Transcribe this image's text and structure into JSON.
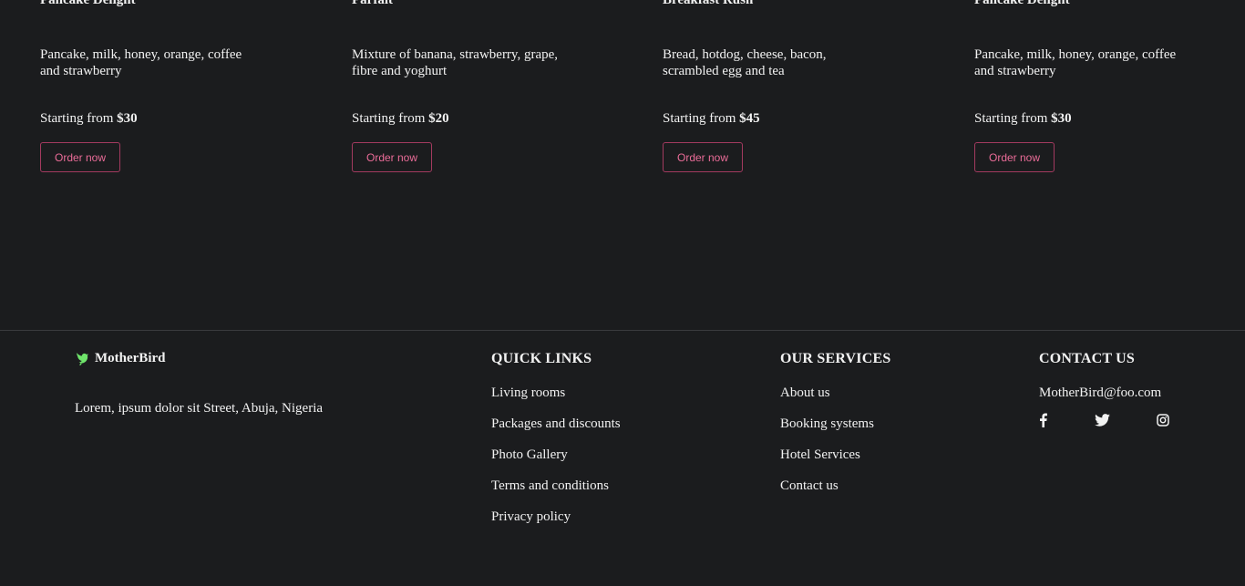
{
  "menu_cards": [
    {
      "title": "Pancake Delight",
      "description": "Pancake, milk, honey, orange, coffee and strawberry",
      "price_prefix": "Starting from ",
      "price": "$30",
      "button_label": "Order now"
    },
    {
      "title": "Parfait",
      "description": "Mixture of banana, strawberry, grape, fibre and yoghurt",
      "price_prefix": "Starting from ",
      "price": "$20",
      "button_label": "Order now"
    },
    {
      "title": "Breakfast Rush",
      "description": "Bread, hotdog, cheese, bacon, scrambled egg and tea",
      "price_prefix": "Starting from ",
      "price": "$45",
      "button_label": "Order now"
    },
    {
      "title": "Pancake Delight",
      "description": "Pancake, milk, honey, orange, coffee and strawberry",
      "price_prefix": "Starting from ",
      "price": "$30",
      "button_label": "Order now"
    }
  ],
  "footer": {
    "brand": {
      "name": "MotherBird",
      "logo_icon": "bird-icon",
      "logo_color": "#6fe46b"
    },
    "address": "Lorem, ipsum dolor sit Street, Abuja, Nigeria",
    "quick_links": {
      "heading": "QUICK LINKS",
      "items": [
        "Living rooms",
        "Packages and discounts",
        "Photo Gallery",
        "Terms and conditions",
        "Privacy policy"
      ]
    },
    "services": {
      "heading": "OUR SERVICES",
      "items": [
        "About us",
        "Booking systems",
        "Hotel Services",
        "Contact us"
      ]
    },
    "contact": {
      "heading": "CONTACT US",
      "email": "MotherBird@foo.com",
      "socials": [
        "facebook-icon",
        "twitter-icon",
        "instagram-icon"
      ]
    }
  },
  "colors": {
    "background": "#1b1c1e",
    "accent": "#ea6c98",
    "accent_border": "#a33a5f",
    "text": "#f2f2f2"
  }
}
